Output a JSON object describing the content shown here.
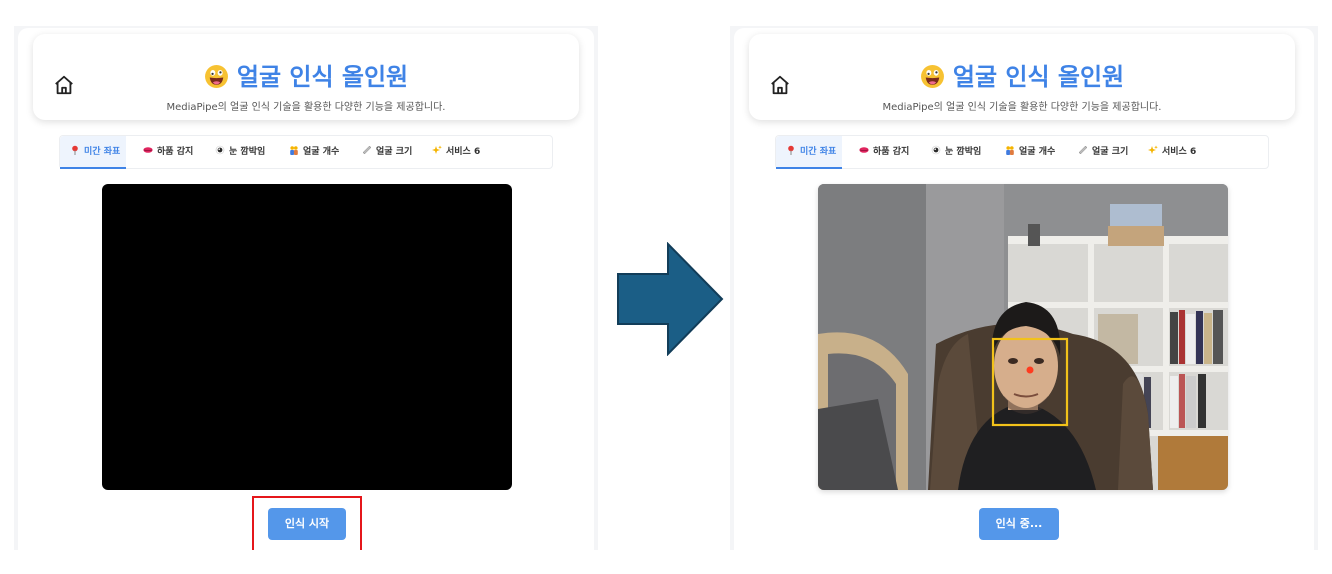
{
  "app": {
    "title": "얼굴 인식 올인원",
    "subtitle": "MediaPipe의 얼굴 인식 기술을 활용한 다양한 기능을 제공합니다."
  },
  "tabs": [
    {
      "label": "미간 좌표",
      "icon": "pin-icon",
      "active": true
    },
    {
      "label": "하품 감지",
      "icon": "lips-icon"
    },
    {
      "label": "눈 깜박임",
      "icon": "eye-icon"
    },
    {
      "label": "얼굴 개수",
      "icon": "people-icon"
    },
    {
      "label": "얼굴 크기",
      "icon": "ruler-icon"
    },
    {
      "label": "서비스 6",
      "icon": "sparkles-icon"
    }
  ],
  "before": {
    "button_label": "인식 시작"
  },
  "after": {
    "button_label": "인식 중..."
  },
  "colors": {
    "accent": "#3f83e6",
    "button": "#5497ea",
    "highlight": "#e5161b",
    "arrow": "#1b5e86",
    "face_box": "#f2c21a",
    "landmark": "#ff3b1f"
  }
}
